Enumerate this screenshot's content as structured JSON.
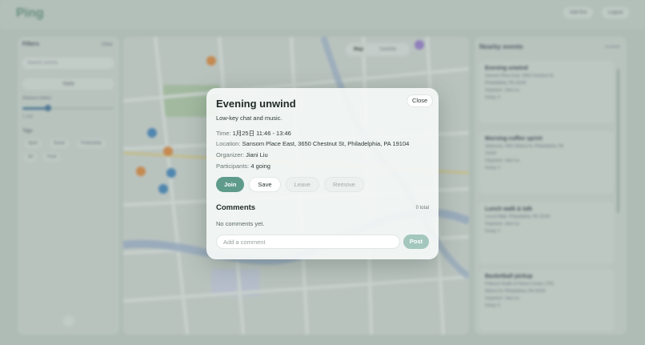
{
  "app": {
    "logo": "Ping",
    "top_buttons": [
      "Add Evt",
      "Logout"
    ]
  },
  "filters": {
    "title": "Filters",
    "reset": "Clear",
    "search_placeholder": "Search events",
    "apply": "Apply",
    "distance_label": "Distance (miles)",
    "distance_value": "1 mile",
    "distance_fraction": 0.25,
    "tags_title": "Tags",
    "tags": [
      "Sport",
      "Social",
      "Productivity",
      "Art",
      "Food"
    ]
  },
  "map": {
    "toggle": [
      "Map",
      "Satellite"
    ]
  },
  "events_panel": {
    "title": "Nearby events",
    "count": "4 events",
    "cards": [
      {
        "name": "Evening unwind",
        "lines": [
          "Sansom Place East, 3650 Chestnut St,",
          "Philadelphia, PA 19104",
          "Organizer: Jiani Liu",
          "Going: 4"
        ]
      },
      {
        "name": "Morning coffee sprint",
        "lines": [
          "Starbucks, 3401 Walnut St, Philadelphia, PA",
          "19104",
          "Organizer: Jiani Liu",
          "Going: 3"
        ]
      },
      {
        "name": "Lunch walk & talk",
        "lines": [
          "Locust Walk, Philadelphia, PA 19104",
          "Organizer: Jiani Liu",
          "Going: 2"
        ]
      },
      {
        "name": "Basketball pickup",
        "lines": [
          "Pottruck Health & Fitness Center, 3701",
          "Walnut St, Philadelphia, PA 19104",
          "Organizer: Jiani Liu",
          "Going: 5"
        ]
      }
    ]
  },
  "modal": {
    "title": "Evening unwind",
    "close": "Close",
    "description": "Low-key chat and music.",
    "time_label": "Time:",
    "time_value": "1月25日 11:46 - 13:46",
    "location_label": "Location:",
    "location_value": "Sansom Place East, 3650 Chestnut St, Philadelphia, PA 19104",
    "organizer_label": "Organizer:",
    "organizer_value": "Jiani Liu",
    "participants_label": "Participants:",
    "participants_value": "4 going",
    "actions": {
      "join": "Join",
      "save": "Save",
      "leave": "Leave",
      "remove": "Remove"
    },
    "comments_title": "Comments",
    "comments_total": "0 total",
    "no_comments": "No comments yet.",
    "comment_placeholder": "Add a comment",
    "post": "Post"
  },
  "colors": {
    "accent": "#5e9b8a",
    "post_disabled": "#a3c7bc",
    "map_marker_blue": "#3d84c4",
    "map_marker_orange": "#e8893a",
    "map_park": "#a7c99a"
  }
}
